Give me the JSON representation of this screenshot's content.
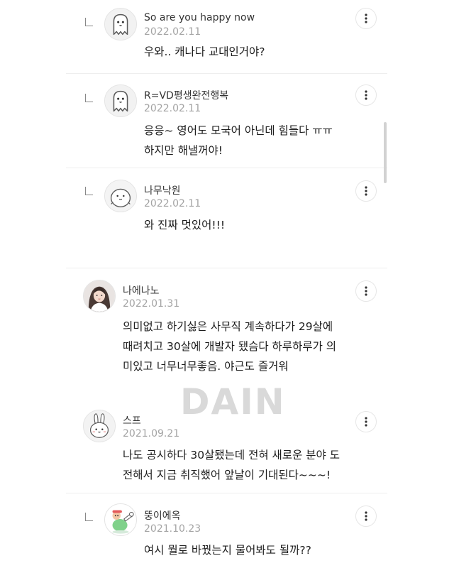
{
  "watermark": "DAIN",
  "comments": [
    {
      "is_reply": true,
      "avatar_icon": "ghost-character-icon",
      "name": "So are you happy now",
      "date": "2022.02.11",
      "text": "우와.. 캐나다 교대인거야?"
    },
    {
      "is_reply": true,
      "avatar_icon": "ghost-character-icon",
      "name": "R=VD평생완전행복",
      "date": "2022.02.11",
      "text": "응응~ 영어도 모국어 아닌데 힘들다 ㅠㅠ\n하지만 해낼꺼야!"
    },
    {
      "is_reply": true,
      "avatar_icon": "round-blob-character-icon",
      "name": "나무낙원",
      "date": "2022.02.11",
      "text": "와 진짜 멋있어!!!"
    },
    {
      "is_reply": false,
      "avatar_icon": "photo-portrait-icon",
      "name": "나에나노",
      "date": "2022.01.31",
      "text": "의미없고 하기싫은 사무직 계속하다가 29살에\n때려치고 30살에 개발자 됐슴다 하루하루가 의\n미있고 너무너무좋음. 야근도 즐거워"
    },
    {
      "is_reply": false,
      "avatar_icon": "bunny-character-icon",
      "name": "스프",
      "date": "2021.09.21",
      "text": "나도 공시하다 30살됐는데 전혀 새로운 분야 도\n전해서 지금 취직했어 앞날이 기대된다~~~!"
    },
    {
      "is_reply": true,
      "avatar_icon": "cartoon-character-icon",
      "name": "뚱이에옥",
      "date": "2021.10.23",
      "text": "여시 뭘로 바꿨는지 물어봐도 될까??"
    }
  ]
}
